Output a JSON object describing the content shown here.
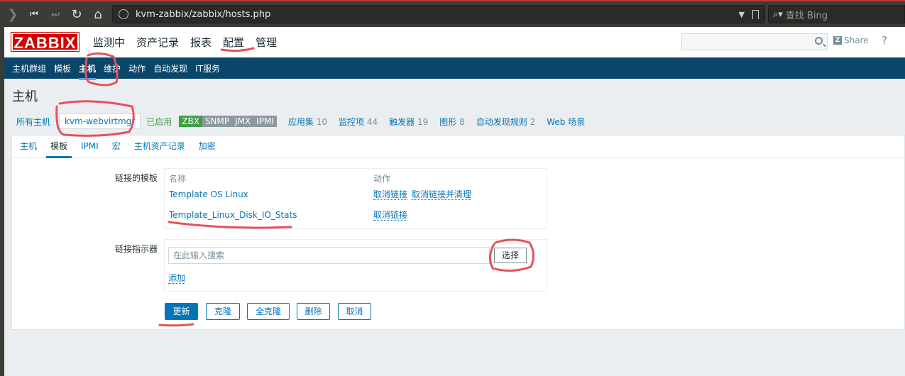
{
  "browser": {
    "url": "kvm-zabbix/zabbix/hosts.php",
    "search_placeholder": "查找 Bing"
  },
  "header": {
    "logo": "ZABBIX",
    "menu": [
      "监测中",
      "资产记录",
      "报表",
      "配置",
      "管理"
    ],
    "share": "Share",
    "help": "?"
  },
  "subnav": {
    "items": [
      "主机群组",
      "模板",
      "主机",
      "维护",
      "动作",
      "自动发现",
      "IT服务"
    ],
    "active": "主机"
  },
  "page": {
    "title": "主机"
  },
  "hostnav": {
    "all_hosts": "所有主机",
    "host": "kvm-webvirtmgr",
    "status": "已启用",
    "availability": [
      "ZBX",
      "SNMP",
      "JMX",
      "IPMI"
    ],
    "links": [
      {
        "label": "应用集",
        "count": "10"
      },
      {
        "label": "监控项",
        "count": "44"
      },
      {
        "label": "触发器",
        "count": "19"
      },
      {
        "label": "图形",
        "count": "8"
      },
      {
        "label": "自动发现规则",
        "count": "2"
      },
      {
        "label": "Web 场景",
        "count": ""
      }
    ]
  },
  "tabs": [
    "主机",
    "模板",
    "IPMI",
    "宏",
    "主机资产记录",
    "加密"
  ],
  "active_tab": "模板",
  "linked_templates": {
    "label": "链接的模板",
    "col_name": "名称",
    "col_action": "动作",
    "rows": [
      {
        "name": "Template OS Linux",
        "actions": [
          "取消链接",
          "取消链接并清理"
        ]
      },
      {
        "name": "Template_Linux_Disk_IO_Stats",
        "actions": [
          "取消链接"
        ]
      }
    ]
  },
  "link_indicator": {
    "label": "链接指示器",
    "placeholder": "在此输入搜索",
    "select": "选择",
    "add": "添加"
  },
  "buttons": {
    "update": "更新",
    "clone": "克隆",
    "full_clone": "全克隆",
    "delete": "删除",
    "cancel": "取消"
  },
  "colors": {
    "zabbix_red": "#d40000",
    "nav_blue": "#0a466a",
    "link_blue": "#0275b8",
    "enabled_green": "#429e47",
    "annotation_red": "#e8505b"
  }
}
